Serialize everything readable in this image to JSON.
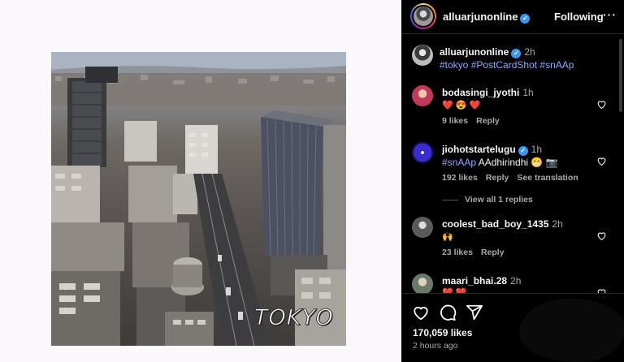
{
  "post": {
    "image_caption": "TOKYO"
  },
  "header": {
    "username": "alluarjunonline",
    "follow_label": "Following",
    "more_label": "···"
  },
  "caption": {
    "username": "alluarjunonline",
    "time": "2h",
    "text": "#tokyo #PostCardShot #snAAp"
  },
  "comments": [
    {
      "username": "bodasingi_jyothi",
      "time": "1h",
      "text": "❤️ 😍 ❤️",
      "likes": "9 likes",
      "reply": "Reply"
    },
    {
      "username": "jiohotstartelugu",
      "time": "1h",
      "text_tag": "#snAAp",
      "text_rest": " AAdhirindhi 😁 📷",
      "likes": "192 likes",
      "reply": "Reply",
      "translate": "See translation",
      "view_replies": "View all 1 replies"
    },
    {
      "username": "coolest_bad_boy_1435",
      "time": "2h",
      "text": "🙌",
      "likes": "23 likes",
      "reply": "Reply"
    },
    {
      "username": "maari_bhai.28",
      "time": "2h",
      "text": "❤️ ❤️"
    }
  ],
  "footer": {
    "likes": "170,059 likes",
    "time_ago": "2 hours ago"
  },
  "icons": [
    "heart-icon",
    "comment-icon",
    "share-icon",
    "verified-badge-icon",
    "more-icon"
  ],
  "colors": {
    "panel_bg": "#000000",
    "hashtag": "#8aa8ff",
    "verified": "#3897f0",
    "muted": "#a8a8a8"
  }
}
